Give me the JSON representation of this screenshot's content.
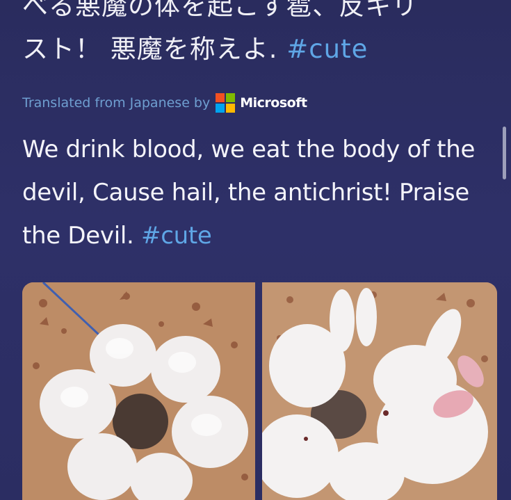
{
  "tweet": {
    "original_text_line1": "べる悪魔の体を起こす雹、反キリ",
    "original_text_line2": "スト！ 悪魔を称えよ. ",
    "original_hashtag": "#cute",
    "translation_label": "Translated from Japanese by",
    "translation_brand": "Microsoft",
    "translation_text": "We drink blood, we eat the body of the devil, Cause hail, the antichrist!   Praise the Devil. ",
    "translation_hashtag": "#cute"
  },
  "colors": {
    "background": "#2c2f63",
    "hashtag": "#5fa6e6",
    "translated_label": "#6f9fd1",
    "ms_red": "#f25022",
    "ms_green": "#7fba00",
    "ms_blue": "#00a4ef",
    "ms_yellow": "#ffb900"
  },
  "icons": {
    "brand_logo": "microsoft-logo-icon"
  },
  "media": {
    "images": [
      "bunnies-circle-photo",
      "bunnies-closeup-photo"
    ]
  }
}
